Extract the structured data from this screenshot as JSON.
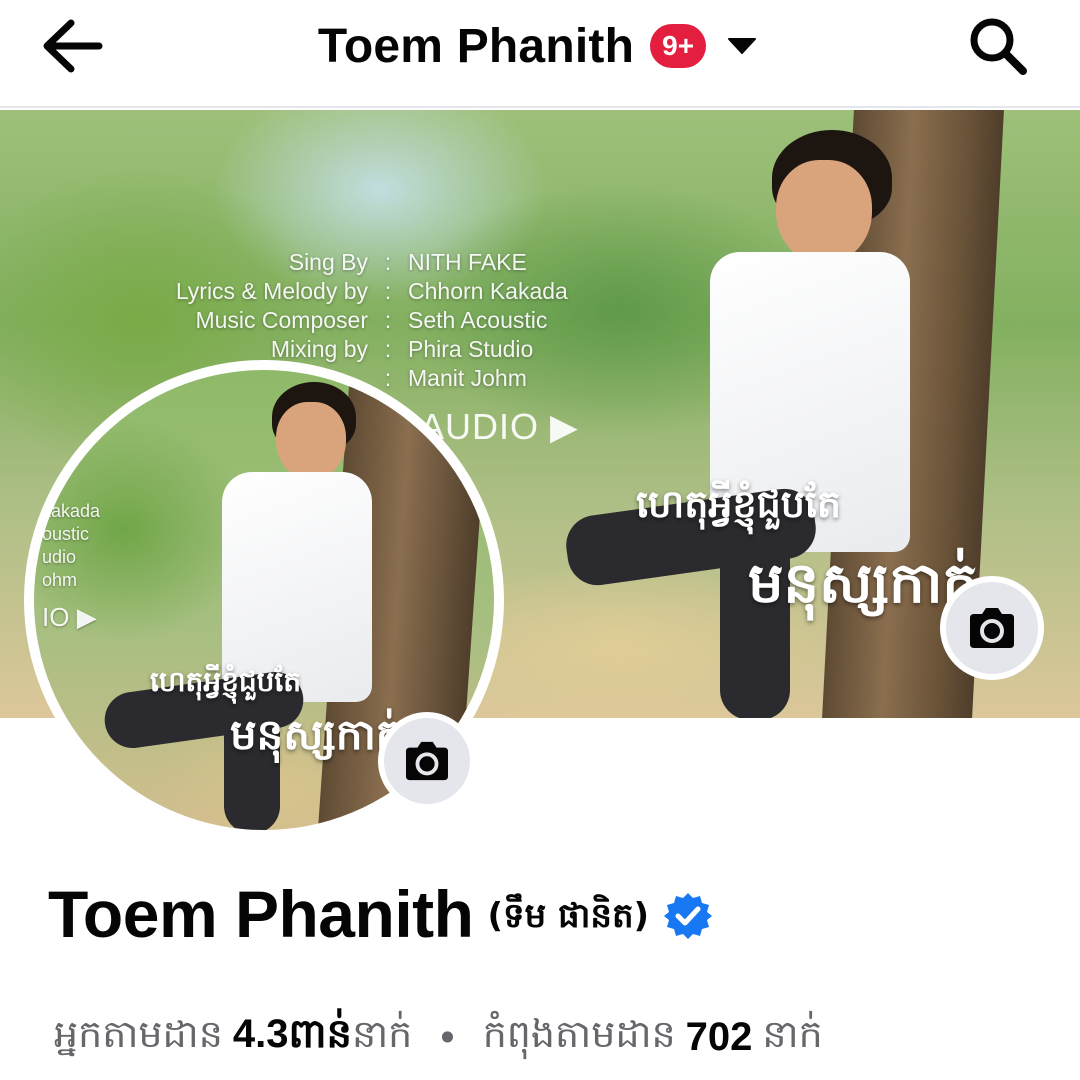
{
  "header": {
    "title": "Toem Phanith",
    "notification_badge": "9+",
    "back_icon": "arrow-left-icon",
    "dropdown_icon": "caret-down-icon",
    "search_icon": "search-icon",
    "badge_color": "#e41e3f"
  },
  "cover": {
    "credits": [
      {
        "role": "Sing By",
        "sep": ":",
        "name": "NITH FAKE"
      },
      {
        "role": "Lyrics & Melody by",
        "sep": ":",
        "name": "Chhorn Kakada"
      },
      {
        "role": "Music Composer",
        "sep": ":",
        "name": "Seth Acoustic"
      },
      {
        "role": "Mixing by",
        "sep": ":",
        "name": "Phira Studio"
      },
      {
        "role": "",
        "sep": ":",
        "name": "Manit Johm"
      }
    ],
    "audio_logo": "AUDIO",
    "song_title_line1": "ហេតុអ្វីខ្ញុំជួបតែ",
    "song_title_line2": "មនុស្សកាក់",
    "camera_icon": "camera-icon"
  },
  "avatar": {
    "side_text": [
      "kakada",
      "oustic",
      "udio",
      "ohm"
    ],
    "audio_logo": "IO",
    "song_title_line1": "ហេតុអ្វីខ្ញុំជួបតែ",
    "song_title_line2": "មនុស្សកាក់",
    "camera_icon": "camera-icon"
  },
  "profile": {
    "name": "Toem Phanith",
    "alt_name": "(ទឹម ផានិត)",
    "verified_icon": "verified-badge-icon",
    "verified_color": "#1877f2",
    "followers_label": "អ្នកតាមដាន",
    "followers_count": "4.3ពាន់",
    "followers_unit": "នាក់",
    "separator": "•",
    "following_label": "កំពុងតាមដាន",
    "following_count": "702",
    "following_unit": "នាក់"
  }
}
